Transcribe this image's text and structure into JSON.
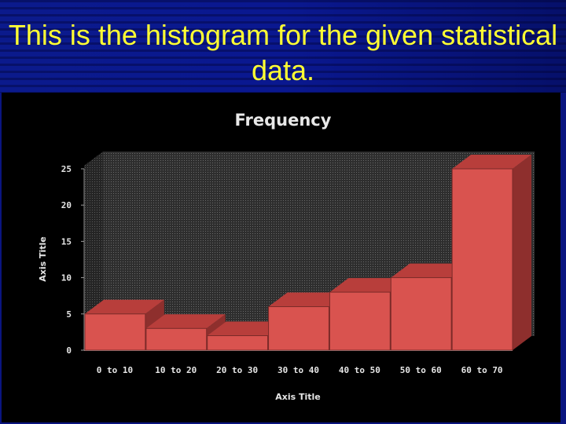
{
  "slide": {
    "title": "This is the histogram for the given statistical data."
  },
  "colors": {
    "title_text": "#ffff33",
    "slide_background": "#0a1580",
    "chart_background": "#000000",
    "bar_front": "#d9534f",
    "bar_top": "#b83e3b",
    "bar_side": "#8e2f2d",
    "wall": "#3a3a3a"
  },
  "chart_data": {
    "type": "bar",
    "style": "3d-column",
    "title": "Frequency",
    "xlabel": "Axis Title",
    "ylabel": "Axis Title",
    "categories": [
      "0 to 10",
      "10 to 20",
      "20 to 30",
      "30 to 40",
      "40 to 50",
      "50 to 60",
      "60 to 70"
    ],
    "values": [
      5,
      3,
      2,
      6,
      8,
      10,
      25
    ],
    "ylim": [
      0,
      25
    ],
    "yticks": [
      0,
      5,
      10,
      15,
      20,
      25
    ],
    "ytick_labels": [
      "0",
      "5",
      "10",
      "15",
      "20",
      "25"
    ],
    "grid": false,
    "legend": "none"
  }
}
